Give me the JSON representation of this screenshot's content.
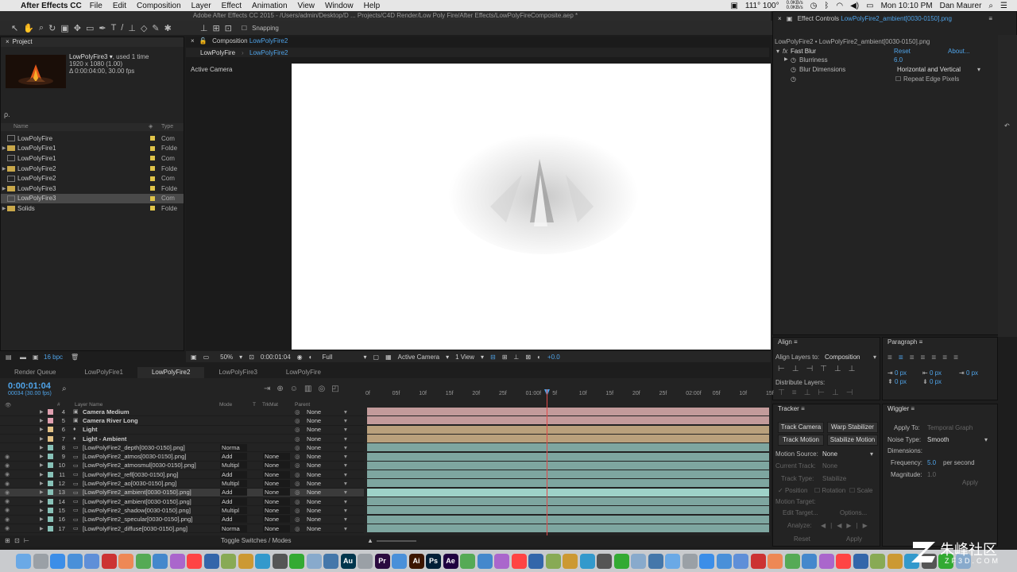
{
  "menubar": {
    "app": "After Effects CC",
    "items": [
      "File",
      "Edit",
      "Composition",
      "Layer",
      "Effect",
      "Animation",
      "View",
      "Window",
      "Help"
    ],
    "network": "0.0KB/s",
    "network2": "0.0KB/s",
    "temps": "111° 100°",
    "clock": "Mon 10:10 PM",
    "user": "Dan Maurer"
  },
  "window_title": "Adobe After Effects CC 2015 - /Users/admin/Desktop/D ... Projects/C4D Render/Low Poly Fire/After Effects/LowPolyFireComposite.aep *",
  "toolbar": {
    "snapping": "Snapping"
  },
  "project": {
    "title": "Project",
    "selected_name": "LowPolyFire3 ▾",
    "used": ", used 1 time",
    "dims": "1920 x 1080 (1.00)",
    "duration": "Δ 0:00:04:00, 30.00 fps",
    "search": "ρ.",
    "col_name": "Name",
    "col_type": "Type",
    "items": [
      {
        "name": "LowPolyFire",
        "type": "Com",
        "kind": "comp",
        "expand": false
      },
      {
        "name": "LowPolyFire1",
        "type": "Folde",
        "kind": "folder",
        "expand": true
      },
      {
        "name": "LowPolyFire1",
        "type": "Com",
        "kind": "comp",
        "expand": false
      },
      {
        "name": "LowPolyFire2",
        "type": "Folde",
        "kind": "folder",
        "expand": true
      },
      {
        "name": "LowPolyFire2",
        "type": "Com",
        "kind": "comp",
        "expand": false
      },
      {
        "name": "LowPolyFire3",
        "type": "Folde",
        "kind": "folder",
        "expand": true
      },
      {
        "name": "LowPolyFire3",
        "type": "Com",
        "kind": "comp",
        "expand": false,
        "selected": true
      },
      {
        "name": "Solids",
        "type": "Folde",
        "kind": "folder",
        "expand": true
      }
    ],
    "bpc": "16 bpc"
  },
  "composition": {
    "label": "Composition",
    "name": "LowPolyFire2",
    "tab1": "LowPolyFire",
    "tab2": "LowPolyFire2",
    "active_camera": "Active Camera",
    "zoom": "50%",
    "time": "0:00:01:04",
    "resolution": "Full",
    "camera": "Active Camera",
    "views": "1 View",
    "exposure": "+0.0"
  },
  "effects": {
    "title": "Effect Controls",
    "layer": "LowPolyFire2_ambient[0030-0150].png",
    "breadcrumb": "LowPolyFire2 • LowPolyFire2_ambient[0030-0150].png",
    "effect": "Fast Blur",
    "reset": "Reset",
    "about": "About...",
    "blurriness_label": "Blurriness",
    "blurriness_value": "6.0",
    "blur_dims_label": "Blur Dimensions",
    "blur_dims_value": "Horizontal and Vertical",
    "repeat_edge": "Repeat Edge Pixels"
  },
  "align": {
    "title": "Align",
    "layers_to_label": "Align Layers to:",
    "layers_to_value": "Composition",
    "distribute": "Distribute Layers:"
  },
  "paragraph": {
    "title": "Paragraph",
    "px": [
      "0 px",
      "0 px",
      "0 px",
      "0 px",
      "0 px"
    ]
  },
  "tracker": {
    "title": "Tracker",
    "track_camera": "Track Camera",
    "warp_stabilizer": "Warp Stabilizer",
    "track_motion": "Track Motion",
    "stabilize_motion": "Stabilize Motion",
    "motion_source_label": "Motion Source:",
    "motion_source_value": "None",
    "current_track_label": "Current Track:",
    "current_track_value": "None",
    "track_type_label": "Track Type:",
    "track_type_value": "Stabilize",
    "position": "Position",
    "rotation": "Rotation",
    "scale": "Scale",
    "motion_target": "Motion Target:",
    "edit_target": "Edit Target...",
    "options": "Options...",
    "analyze": "Analyze:",
    "reset": "Reset",
    "apply": "Apply"
  },
  "wiggler": {
    "title": "Wiggler",
    "apply_to_label": "Apply To:",
    "apply_to_value": "Temporal Graph",
    "noise_type_label": "Noise Type:",
    "noise_type_value": "Smooth",
    "dimensions_label": "Dimensions:",
    "frequency_label": "Frequency:",
    "frequency_value": "5.0",
    "frequency_unit": "per second",
    "magnitude_label": "Magnitude:",
    "magnitude_value": "1.0",
    "apply": "Apply"
  },
  "timeline": {
    "tabs": [
      "Render Queue",
      "LowPolyFire1",
      "LowPolyFire2",
      "LowPolyFire3",
      "LowPolyFire"
    ],
    "active_tab": 2,
    "time": "0:00:01:04",
    "frames": "00034 (30.00 fps)",
    "col_num": "#",
    "col_layer": "Layer Name",
    "col_mode": "Mode",
    "col_t": "T",
    "col_trkmat": "TrkMat",
    "col_parent": "Parent",
    "ruler": [
      "0f",
      "05f",
      "10f",
      "15f",
      "20f",
      "25f",
      "01:00f",
      "5f",
      "10f",
      "15f",
      "20f",
      "25f",
      "02:00f",
      "05f",
      "10f",
      "15f"
    ],
    "toggle": "Toggle Switches / Modes",
    "layers": [
      {
        "num": "4",
        "name": "Camera Medium",
        "mode": "",
        "trk": "",
        "parent": "None",
        "color": "#e0a0b0",
        "bar": "#c39b9b",
        "bold": true
      },
      {
        "num": "5",
        "name": "Camera River Long",
        "mode": "",
        "trk": "",
        "parent": "None",
        "color": "#e0a0b0",
        "bar": "#c39b9b",
        "bold": true
      },
      {
        "num": "6",
        "name": "Light",
        "mode": "",
        "trk": "",
        "parent": "None",
        "color": "#e3c286",
        "bar": "#b9a07c",
        "bold": true
      },
      {
        "num": "7",
        "name": "Light - Ambient",
        "mode": "",
        "trk": "",
        "parent": "None",
        "color": "#e3c286",
        "bar": "#b9a07c",
        "bold": true
      },
      {
        "num": "8",
        "name": "[LowPolyFire2_depth[0030-0150].png]",
        "mode": "Norma",
        "trk": "",
        "parent": "None",
        "color": "#88c2b8",
        "bar": "#7ea6a0"
      },
      {
        "num": "9",
        "name": "[LowPolyFire2_atmos[0030-0150].png]",
        "mode": "Add",
        "trk": "None",
        "parent": "None",
        "color": "#88c2b8",
        "bar": "#7ea6a0"
      },
      {
        "num": "10",
        "name": "[LowPolyFire2_atmosmul[0030-0150].png]",
        "mode": "Multipl",
        "trk": "None",
        "parent": "None",
        "color": "#88c2b8",
        "bar": "#7ea6a0"
      },
      {
        "num": "11",
        "name": "[LowPolyFire2_refl[0030-0150].png]",
        "mode": "Add",
        "trk": "None",
        "parent": "None",
        "color": "#88c2b8",
        "bar": "#7ea6a0"
      },
      {
        "num": "12",
        "name": "[LowPolyFire2_ao[0030-0150].png]",
        "mode": "Multipl",
        "trk": "None",
        "parent": "None",
        "color": "#88c2b8",
        "bar": "#7ea6a0"
      },
      {
        "num": "13",
        "name": "[LowPolyFire2_ambient[0030-0150].png]",
        "mode": "Add",
        "trk": "None",
        "parent": "None",
        "color": "#88c2b8",
        "bar": "#9ed2c8",
        "selected": true
      },
      {
        "num": "14",
        "name": "[LowPolyFire2_ambient[0030-0150].png]",
        "mode": "Add",
        "trk": "None",
        "parent": "None",
        "color": "#88c2b8",
        "bar": "#7ea6a0"
      },
      {
        "num": "15",
        "name": "[LowPolyFire2_shadow[0030-0150].png]",
        "mode": "Multipl",
        "trk": "None",
        "parent": "None",
        "color": "#88c2b8",
        "bar": "#7ea6a0"
      },
      {
        "num": "16",
        "name": "[LowPolyFire2_specular[0030-0150].png]",
        "mode": "Add",
        "trk": "None",
        "parent": "None",
        "color": "#88c2b8",
        "bar": "#7ea6a0"
      },
      {
        "num": "17",
        "name": "[LowPolyFire2_diffuse[0030-0150].png]",
        "mode": "Norma",
        "trk": "None",
        "parent": "None",
        "color": "#88c2b8",
        "bar": "#7ea6a0"
      }
    ]
  },
  "watermark": {
    "text": "朱峰社区",
    "url": "ZF3D.COM"
  },
  "dock_icons": [
    "finder-icon",
    "launchpad-icon",
    "chrome-icon",
    "safari-icon",
    "mail-icon",
    "app-icon",
    "app-icon",
    "app-icon",
    "app-icon",
    "app-icon",
    "app-icon",
    "app-icon",
    "app-icon",
    "app-icon",
    "app-icon",
    "app-icon",
    "app-icon",
    "app-icon",
    "app-icon",
    "audition-icon",
    "app-icon",
    "premiere-icon",
    "app-icon",
    "illustrator-icon",
    "photoshop-icon",
    "aftereffects-icon",
    "app-icon",
    "app-icon",
    "app-icon",
    "app-icon",
    "app-icon",
    "app-icon",
    "app-icon",
    "app-icon",
    "app-icon",
    "app-icon",
    "app-icon",
    "app-icon",
    "app-icon",
    "app-icon",
    "app-icon",
    "app-icon",
    "app-icon",
    "app-icon",
    "app-icon",
    "app-icon",
    "app-icon",
    "app-icon",
    "app-icon",
    "app-icon",
    "app-icon",
    "app-icon",
    "app-icon",
    "app-icon",
    "app-icon",
    "trash-icon"
  ],
  "dock_labels": {
    "au": "Au",
    "pr": "Pr",
    "ai": "Ai",
    "ps": "Ps",
    "ae": "Ae"
  }
}
